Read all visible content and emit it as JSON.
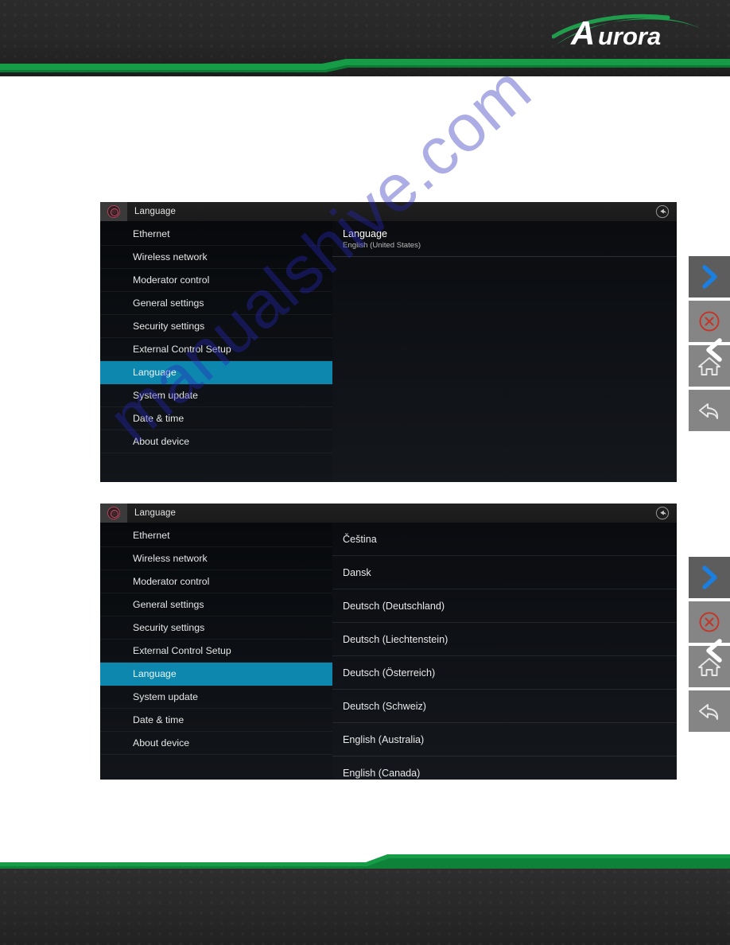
{
  "header": {
    "brand": "Aurora",
    "brand_color": "#1f9d4d",
    "background_color": "#272727"
  },
  "watermark": {
    "text": "manualshive.com",
    "color": "#2828be"
  },
  "panels": [
    {
      "titlebar": {
        "icon": "app-badge-icon",
        "title": "Language",
        "back_icon": "circular-back-arrow-icon"
      },
      "sidebar": {
        "items": [
          {
            "label": "Ethernet",
            "selected": false
          },
          {
            "label": "Wireless network",
            "selected": false
          },
          {
            "label": "Moderator control",
            "selected": false
          },
          {
            "label": "General settings",
            "selected": false
          },
          {
            "label": "Security settings",
            "selected": false
          },
          {
            "label": "External Control Setup",
            "selected": false
          },
          {
            "label": "Language",
            "selected": true
          },
          {
            "label": "System update",
            "selected": false
          },
          {
            "label": "Date & time",
            "selected": false
          },
          {
            "label": "About device",
            "selected": false
          }
        ],
        "selected_color": "#0d87ad"
      },
      "content": {
        "type": "summary",
        "title": "Language",
        "subtitle": "English (United States)"
      }
    },
    {
      "titlebar": {
        "icon": "app-badge-icon",
        "title": "Language",
        "back_icon": "circular-back-arrow-icon"
      },
      "sidebar": {
        "items": [
          {
            "label": "Ethernet",
            "selected": false
          },
          {
            "label": "Wireless network",
            "selected": false
          },
          {
            "label": "Moderator control",
            "selected": false
          },
          {
            "label": "General settings",
            "selected": false
          },
          {
            "label": "Security settings",
            "selected": false
          },
          {
            "label": "External Control Setup",
            "selected": false
          },
          {
            "label": "Language",
            "selected": true
          },
          {
            "label": "System update",
            "selected": false
          },
          {
            "label": "Date & time",
            "selected": false
          },
          {
            "label": "About device",
            "selected": false
          }
        ],
        "selected_color": "#0d87ad"
      },
      "content": {
        "type": "list",
        "items": [
          "Čeština",
          "Dansk",
          "Deutsch (Deutschland)",
          "Deutsch (Liechtenstein)",
          "Deutsch (Österreich)",
          "Deutsch (Schweiz)",
          "English (Australia)",
          "English (Canada)"
        ]
      }
    }
  ],
  "overlay_buttons": [
    {
      "name": "next-chevron-button",
      "icon": "chevron-right-icon",
      "color": "#1a7fe0"
    },
    {
      "name": "close-button",
      "icon": "close-circle-icon",
      "color": "#c0392b"
    },
    {
      "name": "home-button",
      "icon": "home-icon",
      "color": "#e8e8e8"
    },
    {
      "name": "back-button",
      "icon": "back-arrow-icon",
      "color": "#e8e8e8"
    }
  ]
}
